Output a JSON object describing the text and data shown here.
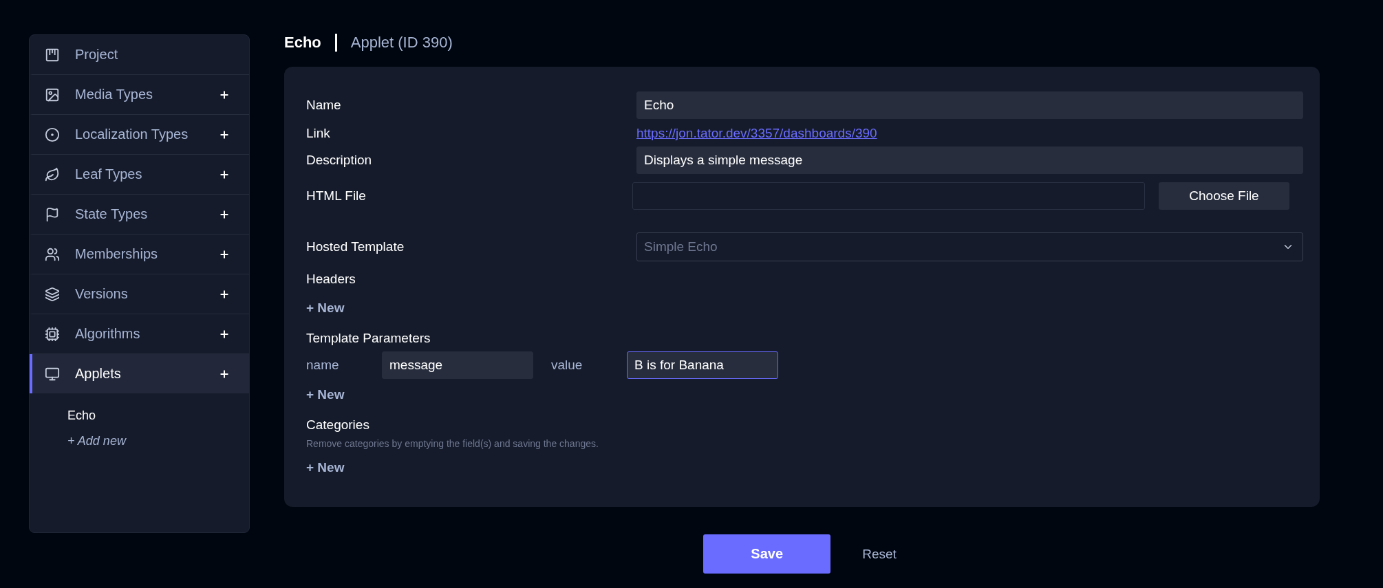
{
  "sidebar": {
    "items": [
      {
        "label": "Project",
        "has_add": false,
        "selected": false
      },
      {
        "label": "Media Types",
        "has_add": true,
        "selected": false
      },
      {
        "label": "Localization Types",
        "has_add": true,
        "selected": false
      },
      {
        "label": "Leaf Types",
        "has_add": true,
        "selected": false
      },
      {
        "label": "State Types",
        "has_add": true,
        "selected": false
      },
      {
        "label": "Memberships",
        "has_add": true,
        "selected": false
      },
      {
        "label": "Versions",
        "has_add": true,
        "selected": false
      },
      {
        "label": "Algorithms",
        "has_add": true,
        "selected": false
      },
      {
        "label": "Applets",
        "has_add": true,
        "selected": true
      }
    ],
    "sub_items": [
      {
        "label": "Echo",
        "kind": "entry"
      },
      {
        "label": "+ Add new",
        "kind": "add"
      }
    ]
  },
  "header": {
    "title": "Echo",
    "subtitle": "Applet (ID 390)"
  },
  "form": {
    "fields": [
      {
        "kind": "text",
        "label": "Name",
        "value": "Echo"
      },
      {
        "kind": "link",
        "label": "Link",
        "value": "https://jon.tator.dev/3357/dashboards/390"
      },
      {
        "kind": "text",
        "label": "Description",
        "value": "Displays a simple message"
      },
      {
        "kind": "file",
        "label": "HTML File",
        "button": "Choose File"
      },
      {
        "kind": "select",
        "label": "Hosted Template",
        "placeholder": "Simple Echo"
      }
    ],
    "sections": [
      {
        "label": "Headers",
        "add": "+ New"
      },
      {
        "label": "Template Parameters",
        "params": [
          {
            "name_label": "name",
            "name": "message",
            "value_label": "value",
            "value": "B is for Banana",
            "focused": true
          }
        ],
        "add": "+ New"
      },
      {
        "label": "Categories",
        "help": "Remove categories by emptying the field(s) and saving the changes.",
        "add": "+ New"
      }
    ]
  },
  "actions": {
    "save": "Save",
    "reset": "Reset"
  }
}
